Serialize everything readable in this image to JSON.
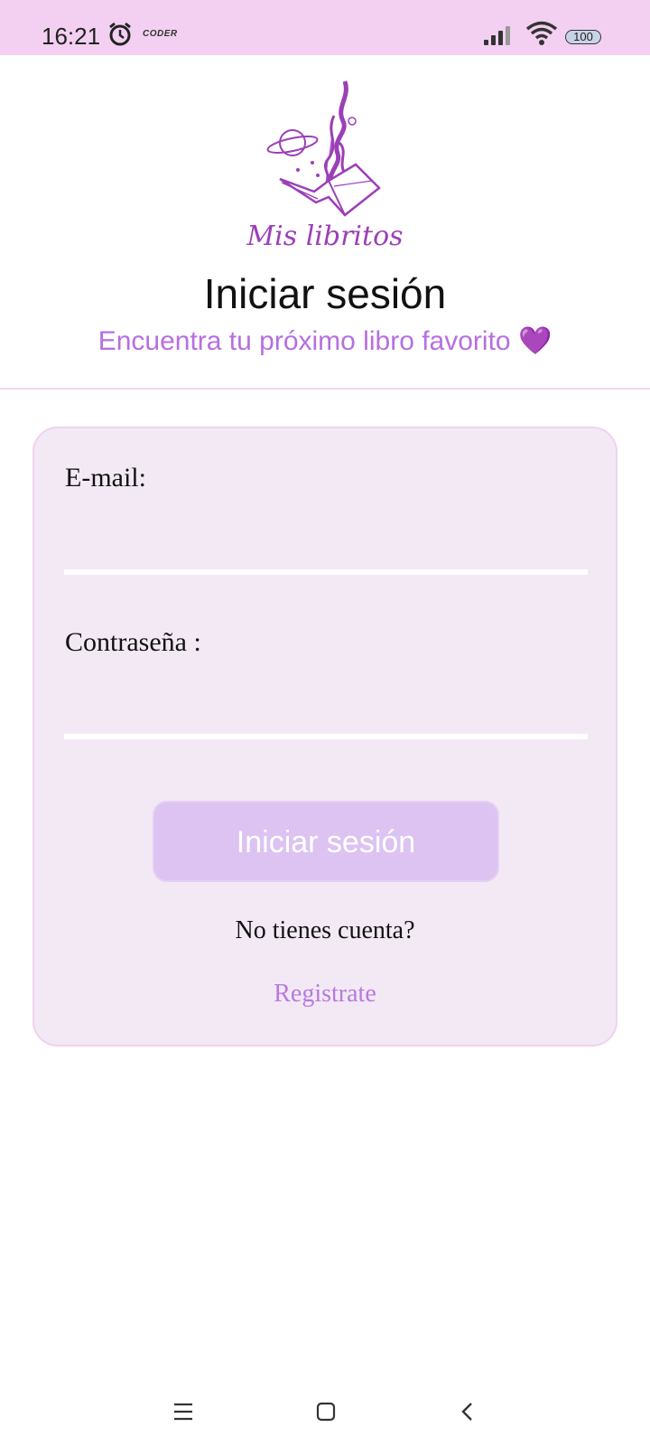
{
  "status_bar": {
    "time": "16:21",
    "carrier_tag": "CODER",
    "battery": "100",
    "icons": [
      "alarm-icon",
      "signal-icon",
      "wifi-icon",
      "battery-icon"
    ]
  },
  "header": {
    "brand": "Mis libritos",
    "title": "Iniciar sesión",
    "subtitle": "Encuentra tu próximo libro favorito",
    "subtitle_emoji": "💜"
  },
  "form": {
    "email_label": "E-mail:",
    "email_value": "",
    "password_label": "Contraseña :",
    "password_value": "",
    "submit_label": "Iniciar sesión",
    "no_account_text": "No tienes cuenta?",
    "register_link": "Registrate"
  },
  "nav": {
    "icons": [
      "menu-icon",
      "home-icon",
      "back-icon"
    ]
  },
  "colors": {
    "status_bar_bg": "#f3d0f1",
    "accent_purple": "#9b3fb7",
    "subtitle": "#b66fe0",
    "card_bg": "#f3e9f5",
    "button_bg": "#dcc3f1",
    "link": "#b67ae0"
  }
}
